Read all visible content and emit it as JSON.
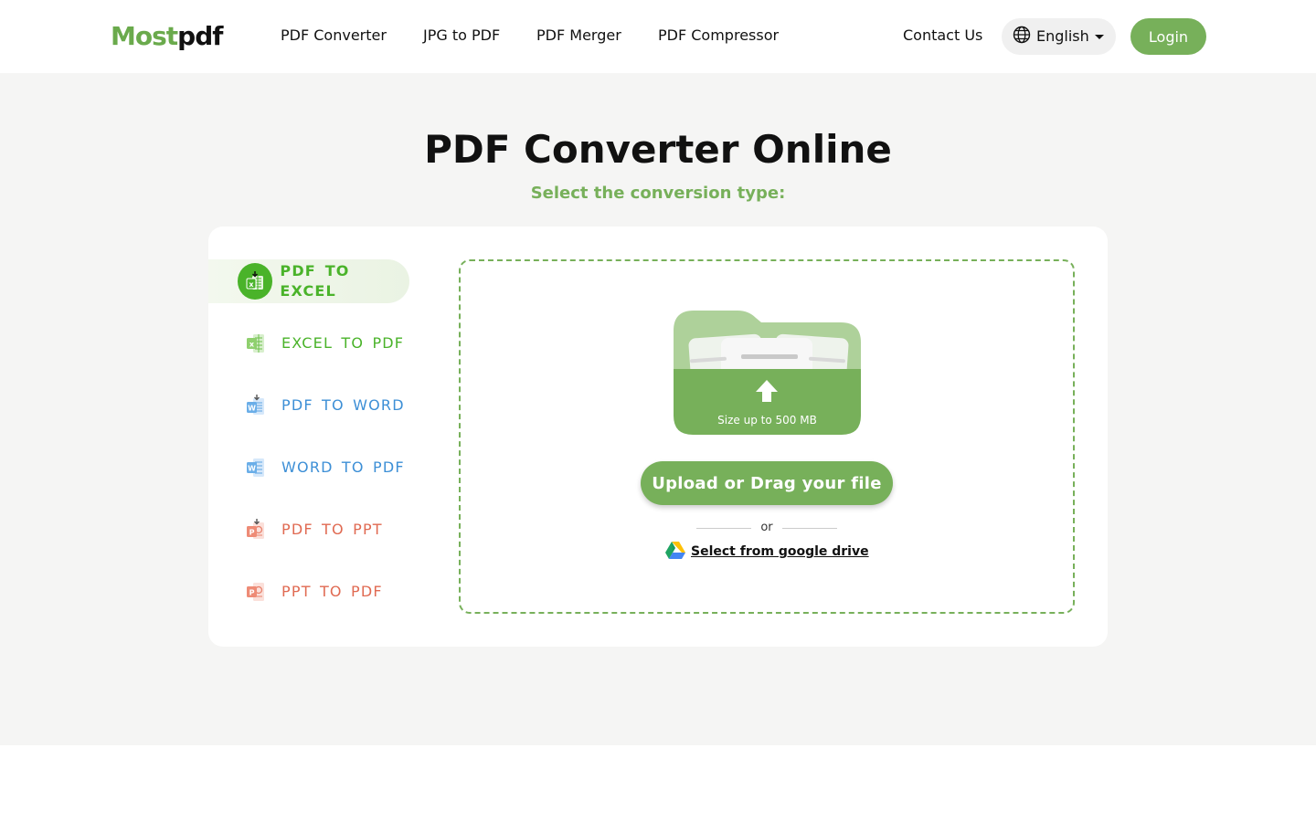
{
  "header": {
    "logo": {
      "part1": "Most",
      "part2": "pdf"
    },
    "nav": [
      "PDF Converter",
      "JPG to PDF",
      "PDF Merger",
      "PDF Compressor"
    ],
    "contact_label": "Contact Us",
    "language": {
      "selected": "English",
      "icon": "globe-icon"
    },
    "login_label": "Login"
  },
  "main": {
    "title": "PDF Converter Online",
    "subtitle": "Select the conversion type:",
    "conversions": [
      {
        "label": "PDF TO EXCEL",
        "icon": "excel-icon",
        "color": "#4ab32a",
        "active": true
      },
      {
        "label": "EXCEL TO PDF",
        "icon": "excel-icon",
        "color": "#4ab32a",
        "active": false
      },
      {
        "label": "PDF TO WORD",
        "icon": "word-icon",
        "color": "#3d8fd6",
        "active": false
      },
      {
        "label": "WORD TO PDF",
        "icon": "word-icon",
        "color": "#3d8fd6",
        "active": false
      },
      {
        "label": "PDF TO PPT",
        "icon": "ppt-icon",
        "color": "#e06a52",
        "active": false
      },
      {
        "label": "PPT TO PDF",
        "icon": "ppt-icon",
        "color": "#e06a52",
        "active": false
      }
    ],
    "upload": {
      "size_text": "Size up to 500 MB",
      "button_label": "Upload or Drag your file",
      "or_text": "or",
      "gdrive_label": "Select from google drive"
    }
  },
  "colors": {
    "brand_green": "#77b05a",
    "active_green": "#4ab32a",
    "word_blue": "#3d8fd6",
    "ppt_red": "#e06a52",
    "background": "#f5f5f4"
  }
}
